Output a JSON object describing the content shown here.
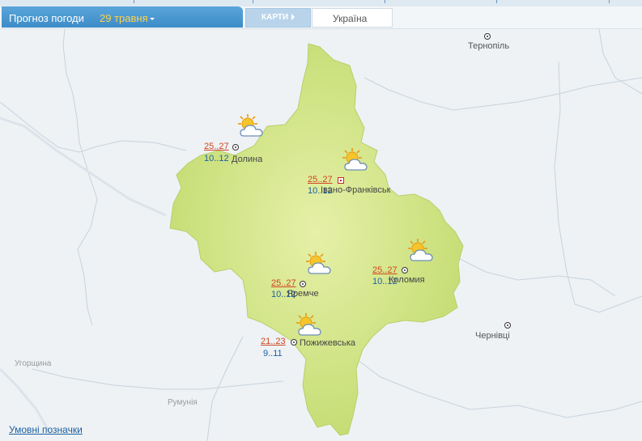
{
  "header": {
    "forecast_label": "Прогноз погоди",
    "date_label": "29 травня",
    "maps_label": "КАРТИ",
    "region_tab_label": "Україна"
  },
  "map": {
    "places": {
      "ternopil": "Тернопіль",
      "chernivtsi": "Чернівці",
      "uhorshchyna": "Угорщина",
      "rumuniia": "Румунія"
    },
    "cities": [
      {
        "name": "Долина",
        "tmax": "25..27",
        "tmin": "10..12",
        "icon": "sun-cloud-icon"
      },
      {
        "name": "Івано-Франківськ",
        "tmax": "25..27",
        "tmin": "10..12",
        "icon": "sun-cloud-icon"
      },
      {
        "name": "Яремче",
        "tmax": "25..27",
        "tmin": "10..12",
        "icon": "sun-cloud-icon"
      },
      {
        "name": "Коломия",
        "tmax": "25..27",
        "tmin": "10..12",
        "icon": "sun-cloud-icon"
      },
      {
        "name": "Пожижевська",
        "tmax": "21..23",
        "tmin": "9..11",
        "icon": "sun-cloud-icon"
      }
    ]
  },
  "footer": {
    "legend_link": "Умовні позначки"
  },
  "colors": {
    "region_fill": "#cfe27e",
    "tab_blue": "#3d8cc8",
    "date_yellow": "#ffd24a",
    "tmax_color": "#d1461f",
    "tmin_color": "#1a5fa3"
  }
}
